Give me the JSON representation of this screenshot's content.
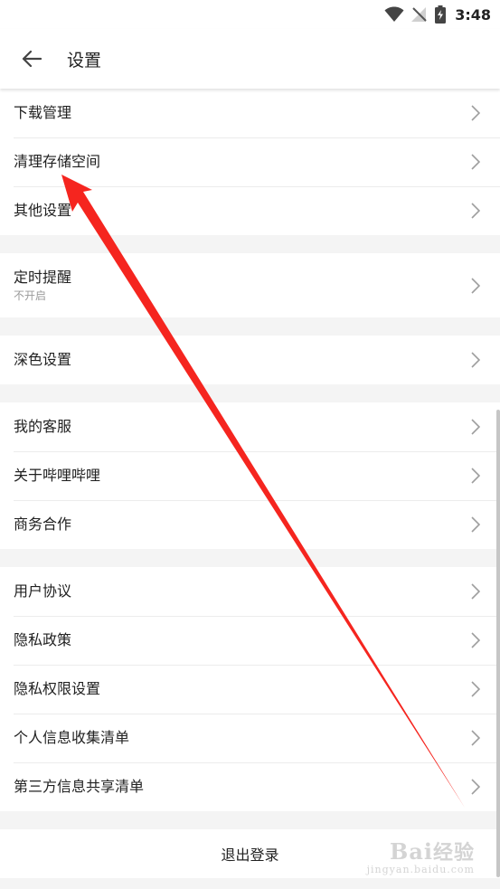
{
  "status_bar": {
    "time": "3:48",
    "icons": [
      "wifi-icon",
      "no-signal-icon",
      "battery-charging-icon"
    ]
  },
  "header": {
    "title": "设置",
    "back_icon": "arrow-left-icon"
  },
  "groups": [
    {
      "items": [
        {
          "label": "下载管理"
        },
        {
          "label": "清理存储空间"
        },
        {
          "label": "其他设置"
        }
      ]
    },
    {
      "items": [
        {
          "label": "定时提醒",
          "sub": "不开启"
        }
      ]
    },
    {
      "items": [
        {
          "label": "深色设置"
        }
      ]
    },
    {
      "items": [
        {
          "label": "我的客服"
        },
        {
          "label": "关于哔哩哔哩"
        },
        {
          "label": "商务合作"
        }
      ]
    },
    {
      "items": [
        {
          "label": "用户协议"
        },
        {
          "label": "隐私政策"
        },
        {
          "label": "隐私权限设置"
        },
        {
          "label": "个人信息收集清单"
        },
        {
          "label": "第三方信息共享清单"
        }
      ]
    }
  ],
  "logout": {
    "label": "退出登录"
  },
  "watermark": {
    "brand_a": "Bai",
    "brand_b": "经验",
    "site": "jingyan.baidu.com"
  },
  "colors": {
    "background": "#f4f4f4",
    "card": "#ffffff",
    "text": "#212121",
    "subtext": "#9a9a9a",
    "annotation_arrow": "#f5251f"
  }
}
